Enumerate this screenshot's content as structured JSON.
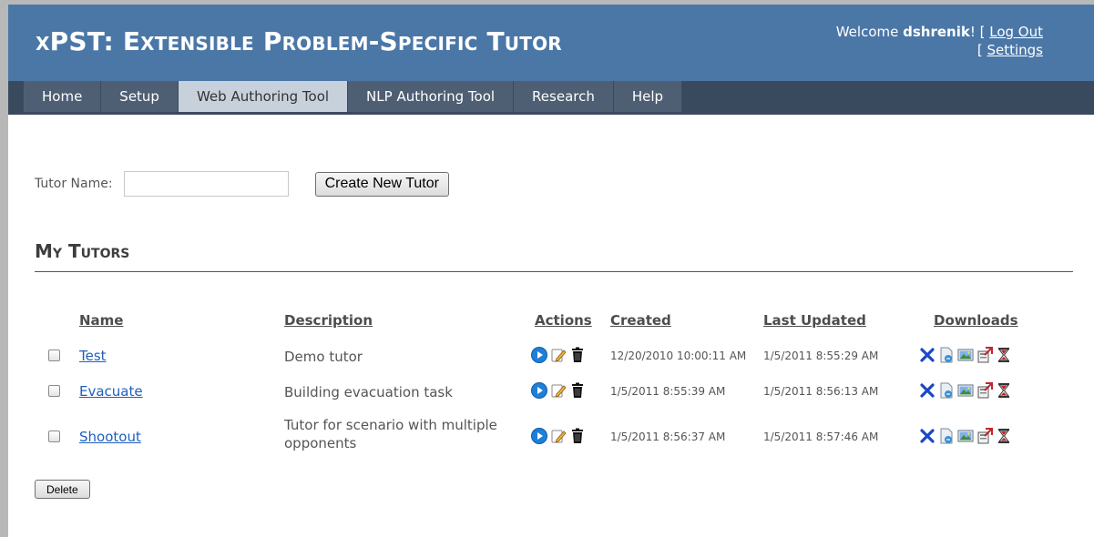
{
  "header": {
    "title": "xPST: Extensible Problem-Specific Tutor",
    "welcome_prefix": "Welcome ",
    "username": "dshrenik",
    "welcome_suffix": "! [ ",
    "logout_label": "Log Out",
    "settings_prefix": "[ ",
    "settings_label": "Settings"
  },
  "nav": {
    "items": [
      {
        "label": "Home"
      },
      {
        "label": "Setup"
      },
      {
        "label": "Web Authoring Tool",
        "active": true
      },
      {
        "label": "NLP Authoring Tool"
      },
      {
        "label": "Research"
      },
      {
        "label": "Help"
      }
    ]
  },
  "create": {
    "label": "Tutor Name:",
    "input_value": "",
    "button_label": "Create New Tutor"
  },
  "my_tutors": {
    "title": "My Tutors",
    "columns": {
      "name": "Name",
      "description": "Description",
      "actions": "Actions",
      "created": "Created",
      "last_updated": "Last Updated",
      "downloads": "Downloads"
    },
    "rows": [
      {
        "name": "Test",
        "description": "Demo tutor",
        "created": "12/20/2010 10:00:11 AM",
        "last_updated": "1/5/2011 8:55:29 AM"
      },
      {
        "name": "Evacuate",
        "description": "Building evacuation task",
        "created": "1/5/2011 8:55:39 AM",
        "last_updated": "1/5/2011 8:56:13 AM"
      },
      {
        "name": "Shootout",
        "description": "Tutor for scenario with multiple opponents",
        "created": "1/5/2011 8:56:37 AM",
        "last_updated": "1/5/2011 8:57:46 AM"
      }
    ],
    "action_icons": [
      "play-icon",
      "edit-icon",
      "trash-icon"
    ],
    "download_icons": [
      "x-icon",
      "document-icon",
      "image-icon",
      "export-icon",
      "hourglass-icon"
    ],
    "delete_label": "Delete"
  },
  "colors": {
    "header_bg": "#4b77a7",
    "nav_bg": "#3a4a5e",
    "nav_active_bg": "#c7d1dc",
    "link": "#1f5fbf"
  }
}
